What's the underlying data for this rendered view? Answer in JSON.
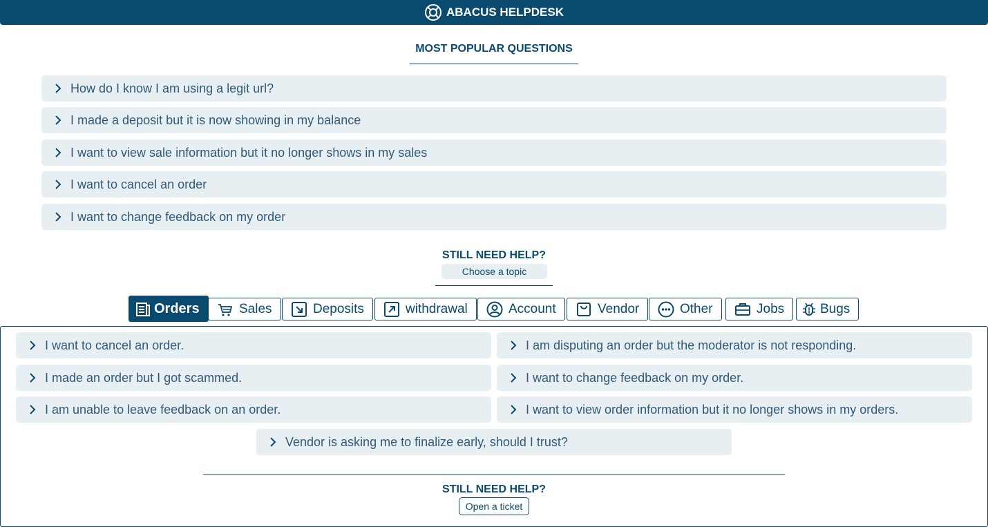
{
  "header": {
    "title": "ABACUS HELPDESK",
    "icon": "lifebuoy-icon"
  },
  "popular": {
    "title": "MOST POPULAR QUESTIONS",
    "questions": [
      "How do I know I am using a legit url?",
      "I made a deposit but it is now showing in my balance",
      "I want to view sale information but it no longer shows in my sales",
      "I want to cancel an order",
      "I want to change feedback on my order"
    ]
  },
  "help_topics": {
    "title": "STILL NEED HELP?",
    "choose_label": "Choose a topic",
    "tabs": [
      {
        "label": "Orders",
        "icon": "document-icon",
        "active": true
      },
      {
        "label": "Sales",
        "icon": "cart-icon"
      },
      {
        "label": "Deposits",
        "icon": "arrow-down-right-icon"
      },
      {
        "label": "withdrawal",
        "icon": "arrow-up-right-icon"
      },
      {
        "label": "Account",
        "icon": "user-circle-icon"
      },
      {
        "label": "Vendor",
        "icon": "bag-icon"
      },
      {
        "label": "Other",
        "icon": "dots-circle-icon"
      },
      {
        "label": "Jobs",
        "icon": "briefcase-icon"
      },
      {
        "label": "Bugs",
        "icon": "bug-icon"
      }
    ]
  },
  "orders_faq": {
    "left": [
      "I want to cancel an order.",
      "I made an order but I got scammed.",
      "I am unable to leave feedback on an order."
    ],
    "right": [
      "I am disputing an order but the moderator is not responding.",
      "I want to change feedback on my order.",
      "I want to view order information but it no longer shows in my orders."
    ],
    "center": "Vendor is asking me to finalize early, should I trust?"
  },
  "footer": {
    "title": "STILL NEED HELP?",
    "ticket_label": "Open a ticket"
  },
  "colors": {
    "primary": "#0b4a6f",
    "item_bg": "#e8eff2",
    "item_text": "#2f5a7a"
  }
}
